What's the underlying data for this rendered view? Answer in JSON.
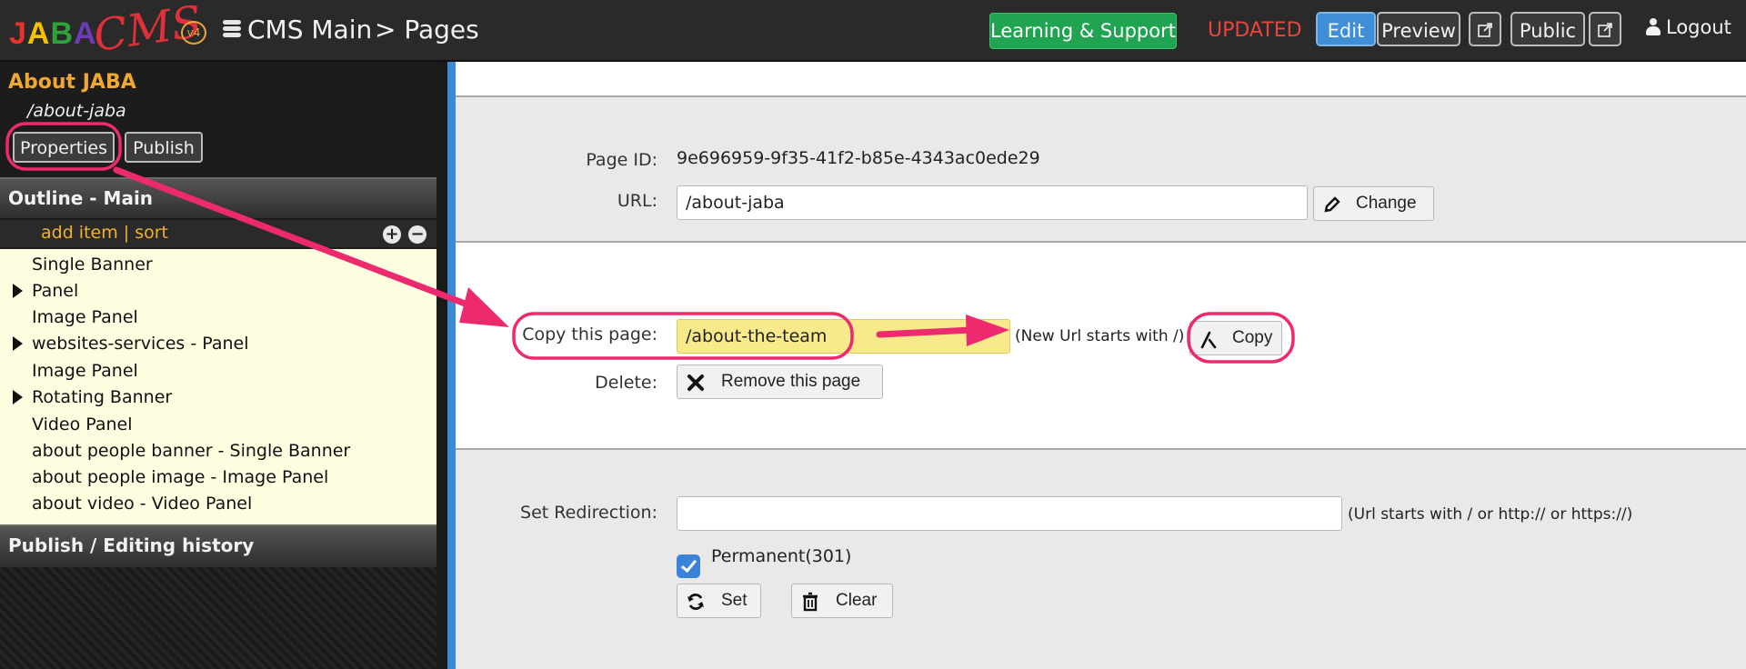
{
  "app": {
    "logo_text": "JABA",
    "logo_cms": "CMS",
    "logo_version": "v4",
    "breadcrumb_section": "CMS Main",
    "breadcrumb_page": "> Pages"
  },
  "topbar": {
    "learning_label": "Learning & Support",
    "status": "UPDATED",
    "edit_label": "Edit",
    "preview_label": "Preview",
    "public_label": "Public",
    "logout_label": "Logout",
    "icons": [
      "stack-icon",
      "external-link-icon",
      "user-icon"
    ]
  },
  "sidebar": {
    "page_title": "About JABA",
    "page_url": "/about-jaba",
    "properties_label": "Properties",
    "publish_label": "Publish",
    "outline_title": "Outline - Main",
    "add_item_label": "add item | sort",
    "outline_items": [
      {
        "label": "Single Banner",
        "expandable": false
      },
      {
        "label": "Panel",
        "expandable": true
      },
      {
        "label": "Image Panel",
        "expandable": false
      },
      {
        "label": "websites-services - Panel",
        "expandable": true
      },
      {
        "label": "Image Panel",
        "expandable": false
      },
      {
        "label": "Rotating Banner",
        "expandable": true
      },
      {
        "label": "Video Panel",
        "expandable": false
      },
      {
        "label": "about people banner - Single Banner",
        "expandable": false
      },
      {
        "label": "about people image - Image Panel",
        "expandable": false
      },
      {
        "label": "about video - Video Panel",
        "expandable": false
      }
    ],
    "history_title": "Publish / Editing history"
  },
  "properties": {
    "page_id_label": "Page ID:",
    "page_id": "9e696959-9f35-41f2-b85e-4343ac0ede29",
    "url_label": "URL:",
    "url_value": "/about-jaba",
    "change_label": "Change",
    "copy_label": "Copy this page:",
    "copy_value": "/about-the-team",
    "copy_hint": "(New Url starts with /)",
    "copy_button": "Copy",
    "delete_label": "Delete:",
    "remove_label": "Remove this page",
    "redirect_label": "Set Redirection:",
    "redirect_value": "",
    "redirect_hint": "(Url starts with / or http:// or https://)",
    "permanent_label": "Permanent(301)",
    "permanent_checked": true,
    "set_label": "Set",
    "clear_label": "Clear"
  },
  "colors": {
    "annotation": "#ee2a6e",
    "accent_blue": "#3b8ad6",
    "learning_green": "#21a452",
    "updated_red": "#e8453c",
    "sidebar_orange": "#f0a830",
    "outline_bg": "#fdfde0",
    "copy_field_yellow": "#f8e98c"
  }
}
